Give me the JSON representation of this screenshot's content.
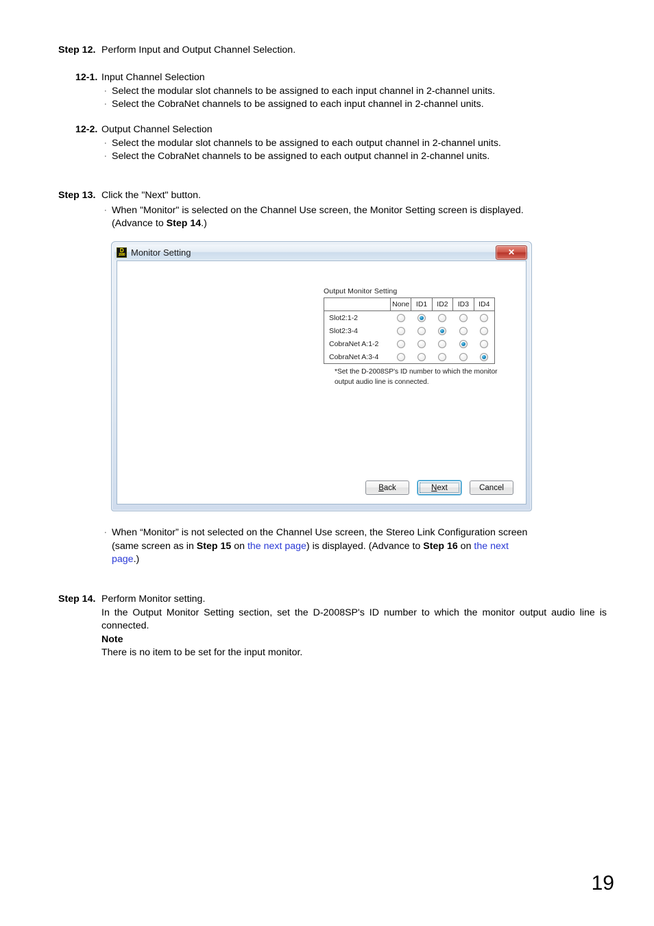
{
  "page": {
    "number": "19"
  },
  "steps": [
    {
      "label": "Step 12.",
      "text": "Perform Input and Output Channel Selection.",
      "substeps": [
        {
          "label": "12-1.",
          "title": "Input Channel Selection",
          "bullets": [
            "Select the modular slot channels to be assigned to each input channel in 2-channel units.",
            "Select the CobraNet channels to be assigned to each input channel in 2-channel units."
          ]
        },
        {
          "label": "12-2.",
          "title": "Output Channel Selection",
          "bullets": [
            "Select the modular slot channels to be assigned to each output channel in 2-channel units.",
            "Select the CobraNet channels to be assigned to each output channel in 2-channel units."
          ]
        }
      ]
    }
  ],
  "step13": {
    "label": "Step 13.",
    "text": "Click the \"Next\" button.",
    "bullet_part1": "When \"Monitor\" is selected on the Channel Use screen, the Monitor Setting screen is displayed.",
    "bullet_part2_pre": "(Advance to ",
    "bullet_part2_bold": "Step 14",
    "bullet_part2_post": ".)"
  },
  "step13b": {
    "line1": "When “Monitor” is not selected on the Channel Use screen, the Stereo Link Configuration screen",
    "line2_a": "(same screen as in ",
    "line2_bold1": "Step 15",
    "line2_b": " on ",
    "line2_link1": "the next page",
    "line2_c": ") is displayed. (Advance to ",
    "line2_bold2": "Step 16",
    "line2_d": " on ",
    "line2_link2": "the next",
    "line3_link": "page",
    "line3_tail": ".)"
  },
  "step14": {
    "label": "Step 14.",
    "text": "Perform Monitor setting.",
    "body": "In the Output Monitor Setting section, set the D-2008SP's ID number to which the monitor output audio line is connected.",
    "note_label": "Note",
    "note_text": "There is no item to be set for the input monitor."
  },
  "dialog": {
    "title": "Monitor Setting",
    "icon_top": "D",
    "icon_bottom": "2000",
    "close_label": "✕",
    "group_title": "Output Monitor Setting",
    "columns": [
      "",
      "None",
      "ID1",
      "ID2",
      "ID3",
      "ID4"
    ],
    "rows": [
      {
        "label": "Slot2:1-2",
        "selected": 1
      },
      {
        "label": "Slot2:3-4",
        "selected": 2
      },
      {
        "label": "CobraNet A:1-2",
        "selected": 3
      },
      {
        "label": "CobraNet A:3-4",
        "selected": 4
      }
    ],
    "note_line1": "*Set the D-2008SP's ID number to which the monitor",
    "note_line2": "output audio line is connected.",
    "buttons": [
      {
        "name": "back",
        "mnemonic": "B",
        "rest": "ack",
        "focused": false
      },
      {
        "name": "next",
        "mnemonic": "N",
        "rest": "ext",
        "focused": true
      },
      {
        "name": "cancel",
        "mnemonic": "",
        "rest": "Cancel",
        "focused": false
      }
    ]
  },
  "colors": {
    "link": "#2a3ad6",
    "radio_selected": "#1f8fc4",
    "titlebar": "#d9e6f2",
    "close_button": "#b7342a"
  }
}
